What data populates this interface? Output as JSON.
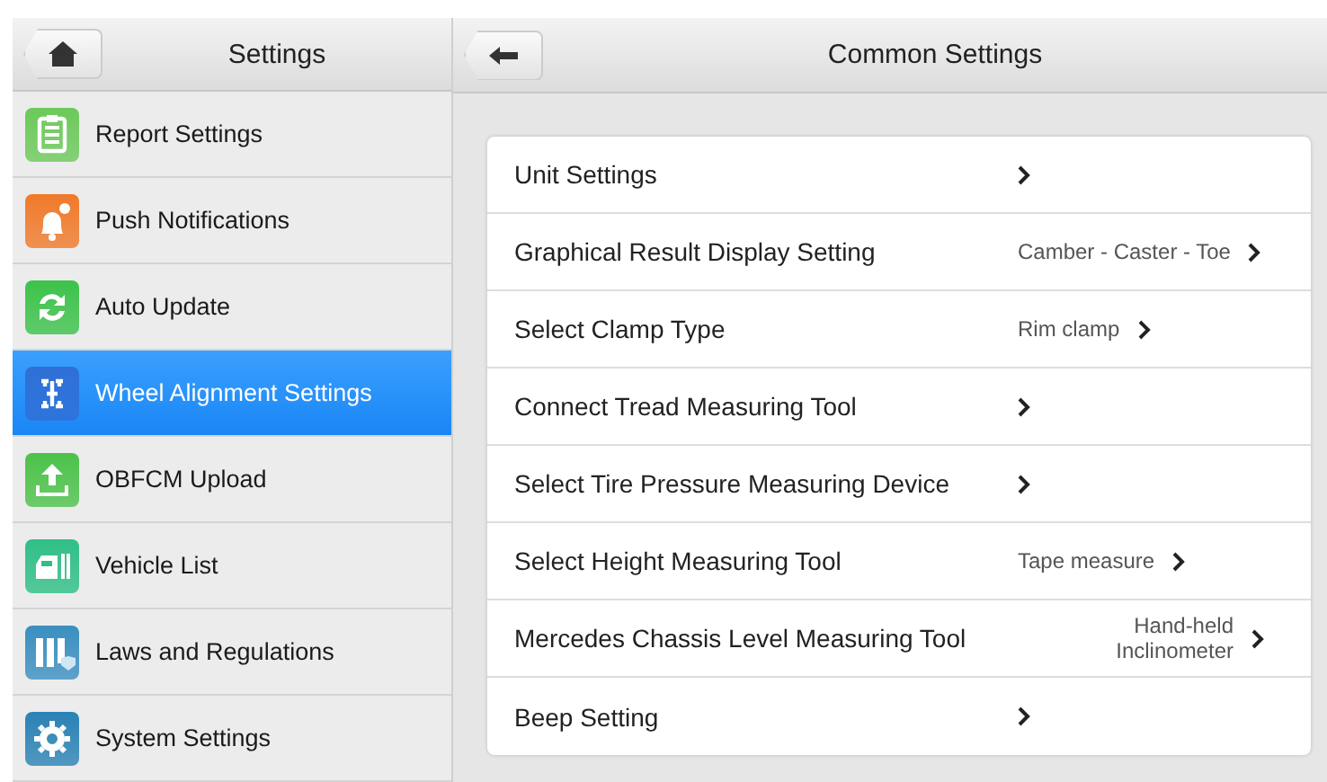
{
  "sidebar": {
    "title": "Settings",
    "items": [
      {
        "label": "Report Settings",
        "color": "#6cc95a",
        "selected": false
      },
      {
        "label": "Push Notifications",
        "color": "#f07a2a",
        "selected": false
      },
      {
        "label": "Auto Update",
        "color": "#3cc24a",
        "selected": false
      },
      {
        "label": "Wheel Alignment Settings",
        "color": "#2f6fd6",
        "selected": true
      },
      {
        "label": "OBFCM Upload",
        "color": "#4cc24a",
        "selected": false
      },
      {
        "label": "Vehicle List",
        "color": "#2fbf86",
        "selected": false
      },
      {
        "label": "Laws and Regulations",
        "color": "#3a8fc0",
        "selected": false
      },
      {
        "label": "System Settings",
        "color": "#2a82b5",
        "selected": false
      }
    ]
  },
  "content": {
    "title": "Common Settings",
    "rows": [
      {
        "label": "Unit Settings"
      },
      {
        "label": "Graphical Result Display Setting",
        "value": "Camber - Caster - Toe"
      },
      {
        "label": "Select Clamp Type",
        "value": "Rim clamp"
      },
      {
        "label": "Connect Tread Measuring Tool"
      },
      {
        "label": "Select Tire Pressure Measuring Device"
      },
      {
        "label": "Select Height Measuring Tool",
        "value": "Tape measure"
      },
      {
        "label": "Mercedes Chassis Level Measuring Tool",
        "value": "Hand-held Inclinometer"
      },
      {
        "label": "Beep Setting"
      }
    ]
  }
}
